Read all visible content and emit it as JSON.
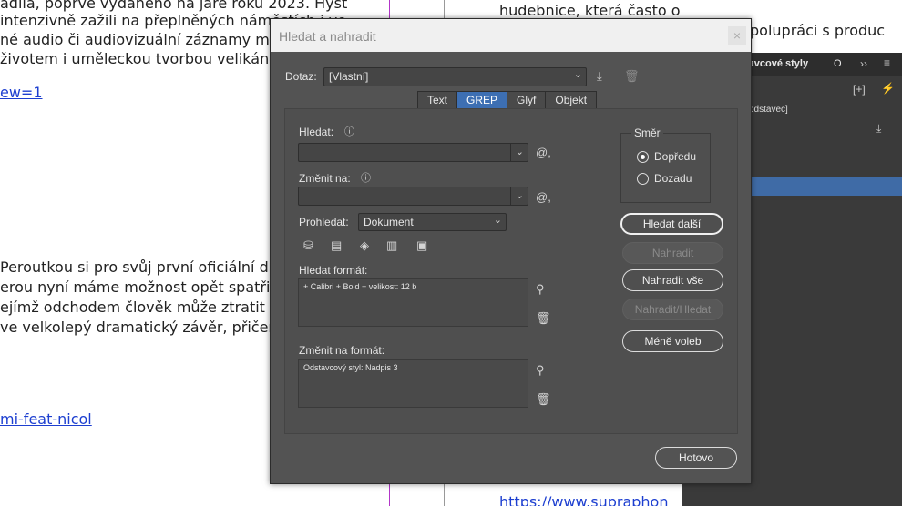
{
  "background": {
    "left_lines": [
      "adila, poprvé vydaného na jaře roku 2023. Hyst",
      " intenzivně zažili na přeplněných náměstích i ve",
      "né audio či audiovizuální záznamy m",
      " životem i uměleckou tvorbou velikán",
      "ew=1",
      "Peroutkou si pro svůj první oficiální d",
      "erou nyní máme možnost opět spatřit",
      "ejímž odchodem člověk může ztratit",
      "ve velkolepý dramatický závěr, přičem",
      "mi-feat-nicol"
    ],
    "right_lines": [
      "hudebnice, která často opouští pro ni typický klavír a",
      "polupráci s produc",
      "https://www.supraphon"
    ]
  },
  "panel": {
    "tab_label": "tavcové styly",
    "tab2": "O",
    "row1": "odstavec]"
  },
  "dialog": {
    "title": "Hledat a nahradit",
    "close": "×",
    "query_label": "Dotaz:",
    "query_value": "[Vlastní]",
    "tabs": [
      "Text",
      "GREP",
      "Glyf",
      "Objekt"
    ],
    "find_label": "Hledat:",
    "find_value": "",
    "change_label": "Změnit na:",
    "change_value": "",
    "search_label": "Prohledat:",
    "search_value": "Dokument",
    "find_format_label": "Hledat formát:",
    "find_format_value": "+ Calibri + Bold + velikost: 12 b",
    "change_format_label": "Změnit na formát:",
    "change_format_value": "Odstavcový styl: Nadpis 3",
    "direction_title": "Směr",
    "direction_forward": "Dopředu",
    "direction_backward": "Dozadu",
    "btn_find_next": "Hledat další",
    "btn_replace": "Nahradit",
    "btn_replace_all": "Nahradit vše",
    "btn_replace_find": "Nahradit/Hledat",
    "btn_fewer": "Méně voleb",
    "btn_done": "Hotovo"
  },
  "colors": {
    "dialog_bg": "#535353",
    "accent": "#3d6fb3",
    "link": "#1d3fd0",
    "guide": "#b235c8"
  }
}
